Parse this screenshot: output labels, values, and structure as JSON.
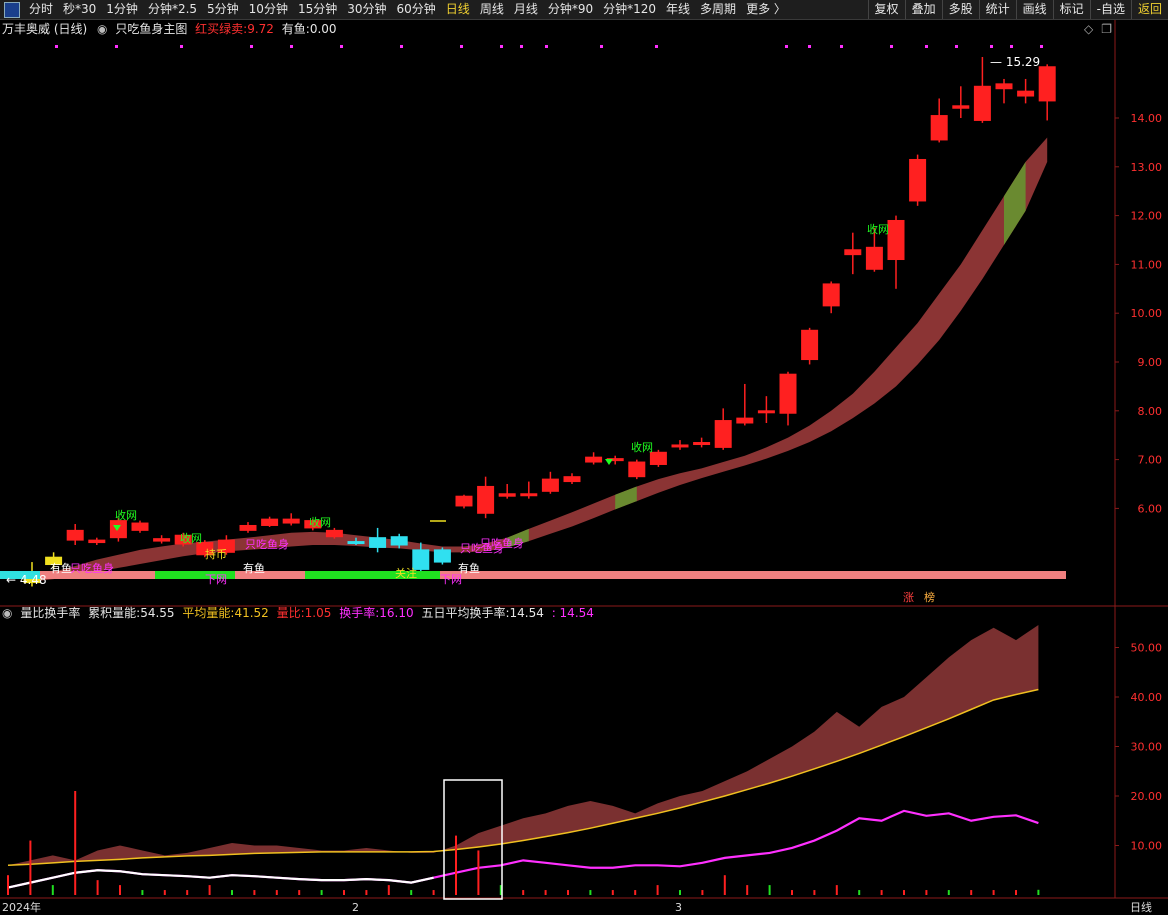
{
  "toolbar": {
    "periods": [
      "分时",
      "秒*30",
      "1分钟",
      "分钟*2.5",
      "5分钟",
      "10分钟",
      "15分钟",
      "30分钟",
      "60分钟",
      "日线",
      "周线",
      "月线",
      "分钟*90",
      "分钟*120",
      "年线",
      "多周期",
      "更多 〉"
    ],
    "active_period": "日线",
    "tools": [
      "复权",
      "叠加",
      "多股",
      "统计",
      "画线",
      "标记",
      "-自选",
      "返回"
    ]
  },
  "main_panel": {
    "stock_title": "万丰奥威 (日线)",
    "indicator_name": "只吃鱼身主图",
    "red_buy_label": "红买绿卖:",
    "red_buy_value": "9.72",
    "has_fish_label": "有鱼:",
    "has_fish_value": "0.00",
    "high_label": "15.29",
    "low_label": "4.48",
    "price_ticks": [
      "14.00",
      "13.00",
      "12.00",
      "11.00",
      "10.00",
      "9.00",
      "8.00",
      "7.00",
      "6.00"
    ],
    "annotations": {
      "shouwang": "收网",
      "xiawang": "下网",
      "youyu": "有鱼",
      "zhichi_yushen": "只吃鱼身",
      "guanzhu": "关注",
      "chibi": "持币"
    },
    "badges": [
      "涨",
      "榜"
    ]
  },
  "sub_panel": {
    "indicator_name": "量比换手率",
    "cum_label": "累积量能:",
    "cum_value": "54.55",
    "avg_label": "平均量能:",
    "avg_value": "41.52",
    "ratio_label": "量比:",
    "ratio_value": "1.05",
    "turnover_label": "换手率:",
    "turnover_value": "16.10",
    "five_day_label": "五日平均换手率:",
    "five_day_value": "14.54",
    "extra_value": "14.54",
    "ticks": [
      "50.00",
      "40.00",
      "30.00",
      "20.00",
      "10.00"
    ]
  },
  "x_axis": {
    "labels": [
      "2024年",
      "2",
      "3"
    ],
    "period_label": "日线"
  },
  "colors": {
    "up": "#ff2020",
    "down": "#30e0f0",
    "band": "#8b3434",
    "band_green": "#6a8a30",
    "magenta": "#ff30ff",
    "gold": "#f0c020"
  },
  "chart_data": {
    "type": "candlestick",
    "price_axis": [
      6,
      14
    ],
    "candles": [
      {
        "o": 4.7,
        "c": 4.48,
        "h": 4.9,
        "l": 4.4
      },
      {
        "o": 4.85,
        "c": 5.0,
        "h": 5.1,
        "l": 4.75
      },
      {
        "o": 5.35,
        "c": 5.55,
        "h": 5.68,
        "l": 5.25
      },
      {
        "o": 5.3,
        "c": 5.35,
        "h": 5.4,
        "l": 5.25
      },
      {
        "o": 5.4,
        "c": 5.75,
        "h": 5.8,
        "l": 5.32
      },
      {
        "o": 5.55,
        "c": 5.7,
        "h": 5.75,
        "l": 5.5
      },
      {
        "o": 5.33,
        "c": 5.38,
        "h": 5.45,
        "l": 5.28
      },
      {
        "o": 5.27,
        "c": 5.45,
        "h": 5.5,
        "l": 5.22
      },
      {
        "o": 5.05,
        "c": 5.3,
        "h": 5.35,
        "l": 5.0
      },
      {
        "o": 5.1,
        "c": 5.35,
        "h": 5.45,
        "l": 5.05
      },
      {
        "o": 5.55,
        "c": 5.65,
        "h": 5.72,
        "l": 5.5
      },
      {
        "o": 5.65,
        "c": 5.78,
        "h": 5.83,
        "l": 5.62
      },
      {
        "o": 5.7,
        "c": 5.78,
        "h": 5.9,
        "l": 5.65
      },
      {
        "o": 5.6,
        "c": 5.75,
        "h": 5.78,
        "l": 5.55
      },
      {
        "o": 5.42,
        "c": 5.55,
        "h": 5.6,
        "l": 5.38
      },
      {
        "o": 5.32,
        "c": 5.3,
        "h": 5.4,
        "l": 5.25
      },
      {
        "o": 5.4,
        "c": 5.2,
        "h": 5.6,
        "l": 5.1
      },
      {
        "o": 5.42,
        "c": 5.25,
        "h": 5.48,
        "l": 5.18
      },
      {
        "o": 5.15,
        "c": 4.75,
        "h": 5.3,
        "l": 4.7
      },
      {
        "o": 5.15,
        "c": 4.9,
        "h": 5.2,
        "l": 4.85
      },
      {
        "o": 6.05,
        "c": 6.25,
        "h": 6.28,
        "l": 6.0
      },
      {
        "o": 5.9,
        "c": 6.45,
        "h": 6.65,
        "l": 5.8
      },
      {
        "o": 6.3,
        "c": 6.25,
        "h": 6.5,
        "l": 6.2
      },
      {
        "o": 6.28,
        "c": 6.3,
        "h": 6.55,
        "l": 6.2
      },
      {
        "o": 6.35,
        "c": 6.6,
        "h": 6.75,
        "l": 6.3
      },
      {
        "o": 6.55,
        "c": 6.65,
        "h": 6.72,
        "l": 6.5
      },
      {
        "o": 6.95,
        "c": 7.05,
        "h": 7.15,
        "l": 6.9
      },
      {
        "o": 7.0,
        "c": 7.02,
        "h": 7.08,
        "l": 6.9
      },
      {
        "o": 6.65,
        "c": 6.95,
        "h": 7.0,
        "l": 6.6
      },
      {
        "o": 6.9,
        "c": 7.15,
        "h": 7.2,
        "l": 6.85
      },
      {
        "o": 7.3,
        "c": 7.3,
        "h": 7.4,
        "l": 7.2
      },
      {
        "o": 7.35,
        "c": 7.35,
        "h": 7.45,
        "l": 7.25
      },
      {
        "o": 7.25,
        "c": 7.8,
        "h": 8.05,
        "l": 7.2
      },
      {
        "o": 7.75,
        "c": 7.85,
        "h": 8.55,
        "l": 7.7
      },
      {
        "o": 8.0,
        "c": 8.0,
        "h": 8.3,
        "l": 7.75
      },
      {
        "o": 7.95,
        "c": 8.75,
        "h": 8.8,
        "l": 7.7
      },
      {
        "o": 9.05,
        "c": 9.65,
        "h": 9.7,
        "l": 8.95
      },
      {
        "o": 10.15,
        "c": 10.6,
        "h": 10.65,
        "l": 10.0
      },
      {
        "o": 11.2,
        "c": 11.3,
        "h": 11.65,
        "l": 10.8
      },
      {
        "o": 10.9,
        "c": 11.35,
        "h": 11.75,
        "l": 10.85
      },
      {
        "o": 11.1,
        "c": 11.9,
        "h": 12.0,
        "l": 10.5
      },
      {
        "o": 12.3,
        "c": 13.15,
        "h": 13.25,
        "l": 12.2
      },
      {
        "o": 13.55,
        "c": 14.05,
        "h": 14.4,
        "l": 13.5
      },
      {
        "o": 14.2,
        "c": 14.25,
        "h": 14.65,
        "l": 14.0
      },
      {
        "o": 13.95,
        "c": 14.65,
        "h": 15.25,
        "l": 13.9
      },
      {
        "o": 14.6,
        "c": 14.7,
        "h": 14.8,
        "l": 14.3
      },
      {
        "o": 14.45,
        "c": 14.55,
        "h": 14.8,
        "l": 14.3
      },
      {
        "o": 14.35,
        "c": 15.05,
        "h": 15.1,
        "l": 13.95
      }
    ],
    "band_upper": [
      4.6,
      4.7,
      4.82,
      4.95,
      5.05,
      5.15,
      5.22,
      5.28,
      5.32,
      5.36,
      5.4,
      5.45,
      5.5,
      5.52,
      5.5,
      5.45,
      5.4,
      5.35,
      5.28,
      5.22,
      5.22,
      5.28,
      5.4,
      5.58,
      5.75,
      5.92,
      6.1,
      6.28,
      6.45,
      6.6,
      6.72,
      6.82,
      6.95,
      7.08,
      7.25,
      7.45,
      7.7,
      8.0,
      8.35,
      8.8,
      9.3,
      9.8,
      10.4,
      11.0,
      11.7,
      12.4,
      13.1,
      13.6
    ],
    "band_lower": [
      4.5,
      4.55,
      4.62,
      4.7,
      4.78,
      4.86,
      4.94,
      5.02,
      5.08,
      5.12,
      5.15,
      5.18,
      5.22,
      5.25,
      5.25,
      5.23,
      5.2,
      5.18,
      5.14,
      5.1,
      5.1,
      5.12,
      5.2,
      5.33,
      5.48,
      5.63,
      5.8,
      5.98,
      6.15,
      6.32,
      6.48,
      6.62,
      6.75,
      6.88,
      7.02,
      7.18,
      7.36,
      7.58,
      7.85,
      8.15,
      8.5,
      8.95,
      9.45,
      10.05,
      10.7,
      11.4,
      12.1,
      13.1
    ],
    "sub_series": {
      "cum_volume": [
        6.0,
        7.0,
        8.0,
        7.0,
        9.0,
        10.0,
        9.0,
        8.0,
        8.5,
        9.5,
        10.5,
        10.0,
        10.0,
        9.5,
        9.0,
        9.0,
        9.5,
        9.0,
        8.5,
        8.5,
        10.0,
        12.5,
        14.0,
        15.5,
        16.5,
        18.0,
        19.0,
        18.0,
        16.5,
        18.5,
        20.0,
        21.0,
        23.0,
        25.0,
        27.5,
        30.0,
        33.0,
        37.0,
        34.0,
        38.0,
        40.0,
        44.0,
        48.0,
        51.5,
        54.0,
        51.5,
        54.55
      ],
      "avg_volume": [
        6.0,
        6.2,
        6.5,
        6.8,
        7.0,
        7.2,
        7.5,
        7.7,
        7.9,
        8.0,
        8.2,
        8.4,
        8.5,
        8.6,
        8.7,
        8.7,
        8.7,
        8.7,
        8.7,
        8.8,
        9.2,
        9.7,
        10.3,
        11.0,
        11.8,
        12.6,
        13.5,
        14.5,
        15.5,
        16.5,
        17.6,
        18.8,
        20.0,
        21.3,
        22.6,
        24.0,
        25.5,
        27.0,
        28.6,
        30.3,
        32.0,
        33.8,
        35.6,
        37.5,
        39.4,
        40.5,
        41.52
      ],
      "turnover": [
        1.5,
        2.5,
        3.5,
        4.5,
        5.0,
        4.8,
        4.2,
        4.0,
        3.8,
        3.5,
        4.0,
        3.8,
        3.5,
        3.2,
        3.0,
        3.0,
        3.2,
        3.0,
        2.5,
        3.5,
        4.5,
        5.5,
        6.0,
        7.0,
        6.5,
        6.0,
        5.5,
        5.5,
        6.0,
        6.0,
        5.8,
        6.5,
        7.5,
        8.0,
        8.5,
        9.5,
        11.0,
        13.0,
        15.5,
        15.0,
        17.0,
        16.0,
        16.5,
        15.0,
        15.8,
        16.1,
        14.54
      ],
      "volume_ratio": [
        4,
        11,
        2,
        21,
        3,
        2,
        1,
        1,
        1,
        2,
        1,
        1,
        1,
        1,
        1,
        1,
        1,
        2,
        1,
        1,
        12,
        9,
        2,
        1,
        1,
        1,
        1,
        1,
        1,
        2,
        1,
        1,
        4,
        2,
        2,
        1,
        1,
        2,
        1,
        1,
        1,
        1,
        1,
        1,
        1,
        1,
        1.05
      ]
    }
  }
}
